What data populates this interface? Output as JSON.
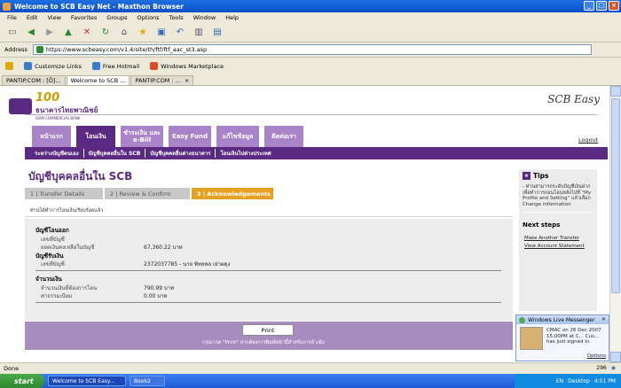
{
  "window": {
    "title": "Welcome to SCB Easy Net - Maxthon Browser"
  },
  "menu": [
    "File",
    "Edit",
    "View",
    "Favorites",
    "Groups",
    "Options",
    "Tools",
    "Window",
    "Help"
  ],
  "address": {
    "label": "Address",
    "url": "https://www.scbeasy.com/v1.4/site/th/ftf/ftf_aac_st3.asp"
  },
  "links": [
    "Customize Links",
    "Free Hotmail",
    "Windows Marketplace"
  ],
  "browser_tabs": [
    "PANTIP.COM : [Ô]...",
    "Welcome to SCB ...",
    "PANTIP.COM : ..."
  ],
  "site": {
    "bank_name": "ธนาคารไทยพาณิชย์",
    "bank_name_en": "SIAM COMMERCIAL BANK",
    "brand": "SCB Easy",
    "logout": "Logout",
    "nav": [
      "หน้าแรก",
      "โอนเงิน",
      "ชำระเงิน และ e-Bill",
      "Easy Fund",
      "แก้ไขข้อมูล",
      "ติดต่อเรา"
    ],
    "subnav": [
      "ระหว่างบัญชีตนเอง",
      "บัญชีบุคคลอื่นใน SCB",
      "บัญชีบุคคลอื่นต่างธนาคาร",
      "โอนเงินไปต่างประเทศ"
    ],
    "page_title": "บัญชีบุคคลอื่นใน SCB",
    "steps": [
      "1 | Transfer Details",
      "2 | Review & Confirm",
      "3 | Acknowledgements"
    ],
    "notice": "ท่านได้ทำการโอนเงินเรียบร้อยแล้ว",
    "from_section": {
      "title": "บัญชีโอนออก",
      "account_label": "เลขที่บัญชี",
      "balance_label": "ยอดเงินคงเหลือในบัญชี",
      "balance_value": "67,360.22 บาท"
    },
    "to_section": {
      "title": "บัญชีรับเงิน",
      "account_label": "เลขที่บัญชี",
      "account_value": "2372037785 - นาย พิทยพล เย่าผดุง"
    },
    "amount_section": {
      "title": "จำนวนเงิน",
      "amount_label": "จำนวนเงินที่ต้องการโอน",
      "amount_value": "790.99 บาท",
      "fee_label": "ค่าธรรมเนียม",
      "fee_value": "0.00 บาท"
    },
    "print_label": "Print",
    "print_note": "กรุณากด \"Print\" หากต้องการพิมพ์หน้านี้สำหรับการอ้างอิง",
    "tips": {
      "title": "Tips",
      "body": "- ท่านสามารถระดับบัญชีเงินฝาก เพื่อทำการถอนโอนหลังไปที่ \"My Profile and Setting\" แล้วเลือก Change information",
      "next_title": "Next steps",
      "next_links": [
        "Make Another Transfer",
        "View Account Statement"
      ]
    }
  },
  "msn": {
    "header": "Windows Live Messenger",
    "message": "CMAC on 26 Dec 2007 15.00PM at C... Cus... has just signed in.",
    "options": "Options"
  },
  "status": {
    "text": "Done",
    "count": "296",
    "lang": "EN",
    "desktop": "Desktop",
    "time": "4:51 PM"
  },
  "taskbar": {
    "start": "start",
    "tasks": [
      "Welcome to SCB Easy...",
      "Book2"
    ]
  }
}
